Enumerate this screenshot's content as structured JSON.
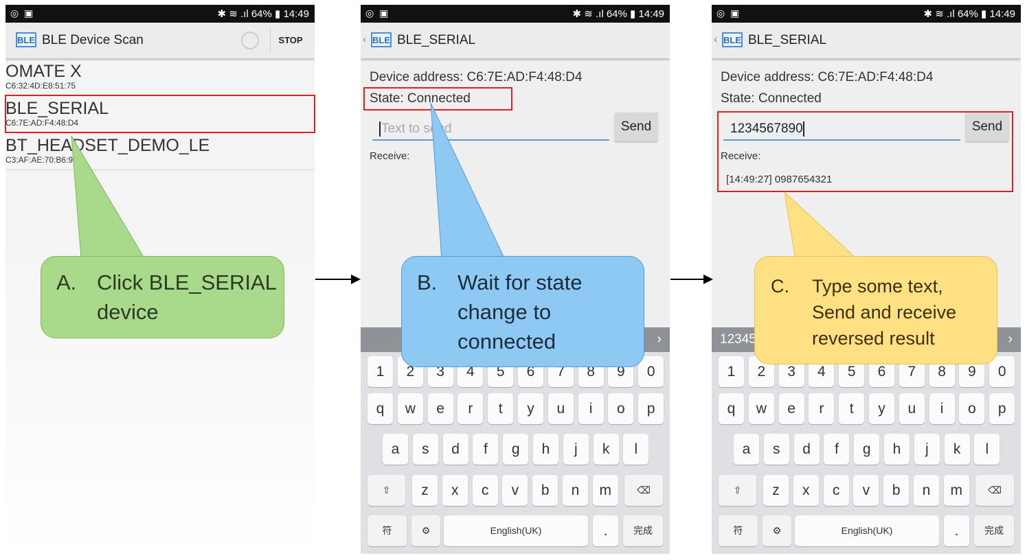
{
  "status_bar": {
    "left_icons": "◎ ▣",
    "right": "✱ ≋ .ıl 64% ▮ 14:49"
  },
  "screen1": {
    "logo": "BLE",
    "title": "BLE Device Scan",
    "stop_label": "STOP",
    "devices": [
      {
        "name": "OMATE X",
        "address": "C6:32:4D:E8:51:75"
      },
      {
        "name": "BLE_SERIAL",
        "address": "C6:7E:AD:F4:48:D4"
      },
      {
        "name": "BT_HEADSET_DEMO_LE",
        "address": "C3:AF:AE:70:B6:9"
      }
    ]
  },
  "screen2": {
    "logo": "BLE",
    "title": "BLE_SERIAL",
    "device_address": "Device address: C6:7E:AD:F4:48:D4",
    "state": "State: Connected",
    "input_placeholder": "Text to send",
    "send_label": "Send",
    "receive_label": "Receive:"
  },
  "screen3": {
    "logo": "BLE",
    "title": "BLE_SERIAL",
    "device_address": "Device address: C6:7E:AD:F4:48:D4",
    "state": "State: Connected",
    "input_value": "1234567890",
    "send_label": "Send",
    "receive_label": "Receive:",
    "received_line": "[14:49:27] 0987654321",
    "suggestion": "12345"
  },
  "keyboard": {
    "numbers": [
      "1",
      "2",
      "3",
      "4",
      "5",
      "6",
      "7",
      "8",
      "9",
      "0"
    ],
    "row1": [
      "q",
      "w",
      "e",
      "r",
      "t",
      "y",
      "u",
      "i",
      "o",
      "p"
    ],
    "row2": [
      "a",
      "s",
      "d",
      "f",
      "g",
      "h",
      "j",
      "k",
      "l"
    ],
    "row3": [
      "z",
      "x",
      "c",
      "v",
      "b",
      "n",
      "m"
    ],
    "shift": "⇧",
    "backspace": "⌫",
    "symbols": "符",
    "settings": "⚙",
    "space": "English(UK)",
    "period": ".",
    "done": "完成"
  },
  "callouts": {
    "a": {
      "label": "A.",
      "text_line1": "Click BLE_SERIAL",
      "text_line2": "device",
      "color": "#a9d98b"
    },
    "b": {
      "label": "B.",
      "text_line1": "Wait for state",
      "text_line2": "change to",
      "text_line3": "connected",
      "color": "#8ec9f4"
    },
    "c": {
      "label": "C.",
      "text_line1": "Type some text,",
      "text_line2": "Send and receive",
      "text_line3": "reversed result",
      "color": "#ffe082"
    }
  },
  "highlight_color": "#e02020"
}
